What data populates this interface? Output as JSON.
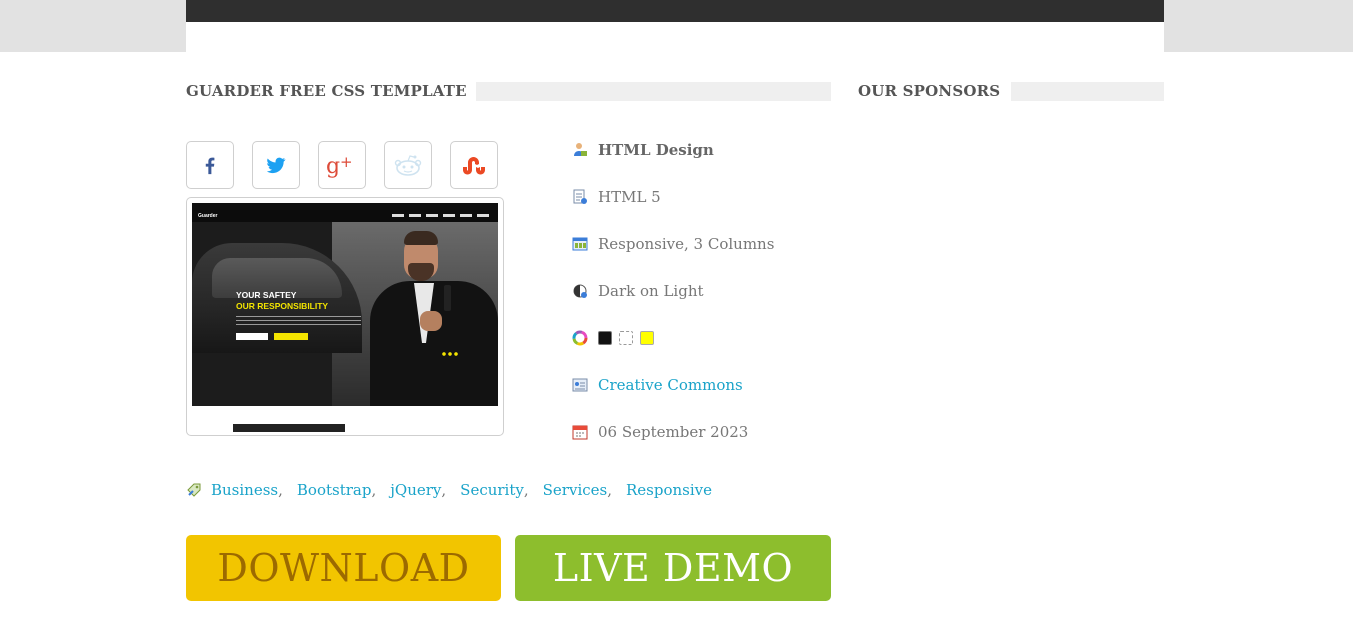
{
  "sections": {
    "template_title": "GUARDER FREE CSS TEMPLATE",
    "sponsors_title": "OUR SPONSORS"
  },
  "social": [
    {
      "name": "facebook",
      "icon": "facebook-icon",
      "color": "#3b5998"
    },
    {
      "name": "twitter",
      "icon": "twitter-icon",
      "color": "#1da1f2"
    },
    {
      "name": "google-plus",
      "icon": "google-plus-icon",
      "color": "#dd4b39"
    },
    {
      "name": "reddit",
      "icon": "reddit-icon",
      "color": "#cfe3f0"
    },
    {
      "name": "stumbleupon",
      "icon": "stumbleupon-icon",
      "color": "#eb4924"
    }
  ],
  "preview": {
    "logo": "Guarder",
    "headline_1": "YOUR SAFTEY",
    "headline_2": "OUR RESPONSIBILITY"
  },
  "specs": {
    "design": "HTML Design",
    "version": "HTML 5",
    "layout": "Responsive, 3 Columns",
    "theme": "Dark on Light",
    "colors": [
      "#111111",
      "#ffffff",
      "#ffff00"
    ],
    "license": "Creative Commons",
    "date": "06 September 2023"
  },
  "tags": [
    "Business",
    "Bootstrap",
    "jQuery",
    "Security",
    "Services",
    "Responsive"
  ],
  "buttons": {
    "download": "DOWNLOAD",
    "live_demo": "LIVE DEMO"
  },
  "colors": {
    "download_bg": "#f2c500",
    "demo_bg": "#8dbe2d",
    "link": "#1aa3c9"
  }
}
